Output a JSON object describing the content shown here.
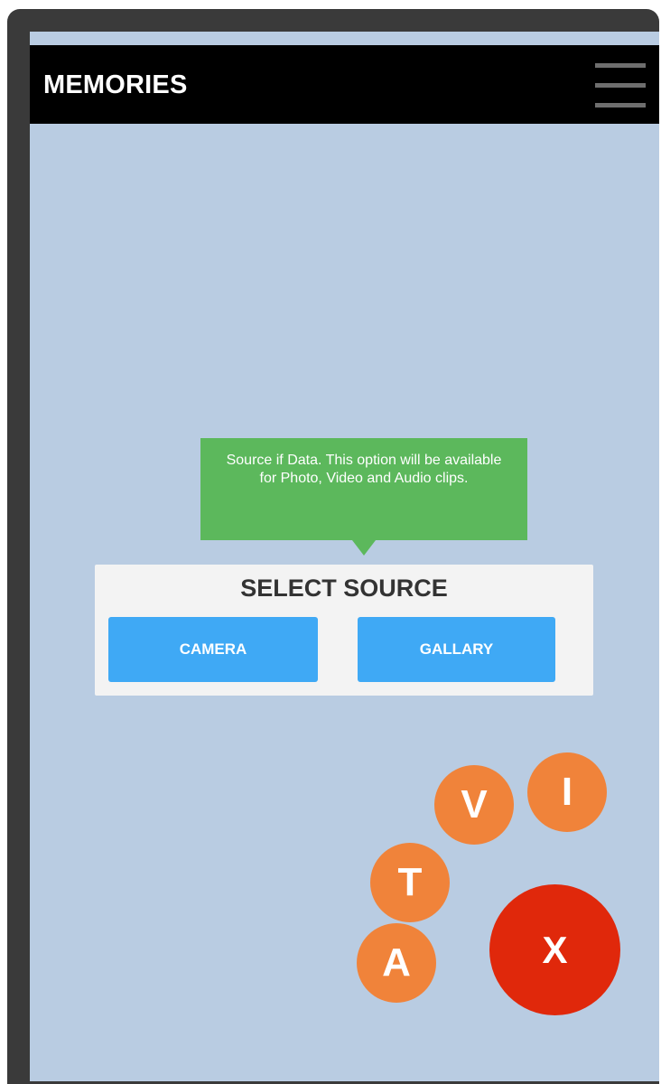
{
  "header": {
    "title": "MEMORIES",
    "menu_icon": "hamburger-menu-icon"
  },
  "tooltip": {
    "text": "Source if Data. This option will be available for Photo, Video and Audio clips."
  },
  "dialog": {
    "title": "SELECT SOURCE",
    "buttons": [
      {
        "label": "CAMERA"
      },
      {
        "label": "GALLARY"
      }
    ]
  },
  "fab_menu": {
    "items": [
      {
        "label": "I"
      },
      {
        "label": "V"
      },
      {
        "label": "T"
      },
      {
        "label": "A"
      }
    ],
    "close_label": "X"
  },
  "colors": {
    "background": "#b9cce2",
    "appbar": "#000000",
    "tooltip": "#5cb85c",
    "button": "#3fa9f5",
    "fab": "#f0833a",
    "fab_close": "#e0280b"
  }
}
